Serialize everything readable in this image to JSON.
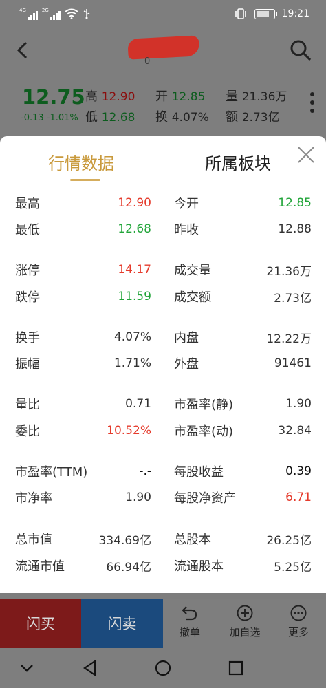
{
  "status_bar": {
    "net1": "4G",
    "net2": "2G",
    "time": "19:21"
  },
  "header": {
    "code": "0"
  },
  "quote": {
    "price": "12.75",
    "change": "-0.13",
    "change_pct": "-1.01%",
    "high_label": "高",
    "high_value": "12.90",
    "low_label": "低",
    "low_value": "12.68",
    "open_label": "开",
    "open_value": "12.85",
    "turnover_label": "换",
    "turnover_value": "4.07%",
    "volume_label": "量",
    "volume_value": "21.36万",
    "amount_label": "额",
    "amount_value": "2.73亿"
  },
  "panel": {
    "tab_active": "行情数据",
    "tab_other": "所属板块",
    "rows": [
      {
        "l_label": "最高",
        "l_value": "12.90",
        "r_label": "今开",
        "r_value": "12.85"
      },
      {
        "l_label": "最低",
        "l_value": "12.68",
        "r_label": "昨收",
        "r_value": "12.88"
      },
      {
        "l_label": "涨停",
        "l_value": "14.17",
        "r_label": "成交量",
        "r_value": "21.36万"
      },
      {
        "l_label": "跌停",
        "l_value": "11.59",
        "r_label": "成交额",
        "r_value": "2.73亿"
      },
      {
        "l_label": "换手",
        "l_value": "4.07%",
        "r_label": "内盘",
        "r_value": "12.22万"
      },
      {
        "l_label": "振幅",
        "l_value": "1.71%",
        "r_label": "外盘",
        "r_value": "91461"
      },
      {
        "l_label": "量比",
        "l_value": "0.71",
        "r_label": "市盈率(静)",
        "r_value": "1.90"
      },
      {
        "l_label": "委比",
        "l_value": "10.52%",
        "r_label": "市盈率(动)",
        "r_value": "32.84"
      },
      {
        "l_label": "市盈率(TTM)",
        "l_value": "-.-",
        "r_label": "每股收益",
        "r_value": "0.39"
      },
      {
        "l_label": "市净率",
        "l_value": "1.90",
        "r_label": "每股净资产",
        "r_value": "6.71"
      },
      {
        "l_label": "总市值",
        "l_value": "334.69亿",
        "r_label": "总股本",
        "r_value": "26.25亿"
      },
      {
        "l_label": "流通市值",
        "l_value": "66.94亿",
        "r_label": "流通股本",
        "r_value": "5.25亿"
      }
    ]
  },
  "actions": {
    "flash_buy": "闪买",
    "flash_sell": "闪卖",
    "cancel": "撤单",
    "add_watch": "加自选",
    "more": "更多"
  },
  "colors": {
    "up_red": "#e53b2c",
    "down_green": "#22a53a",
    "tab_gold": "#c99a3c"
  }
}
